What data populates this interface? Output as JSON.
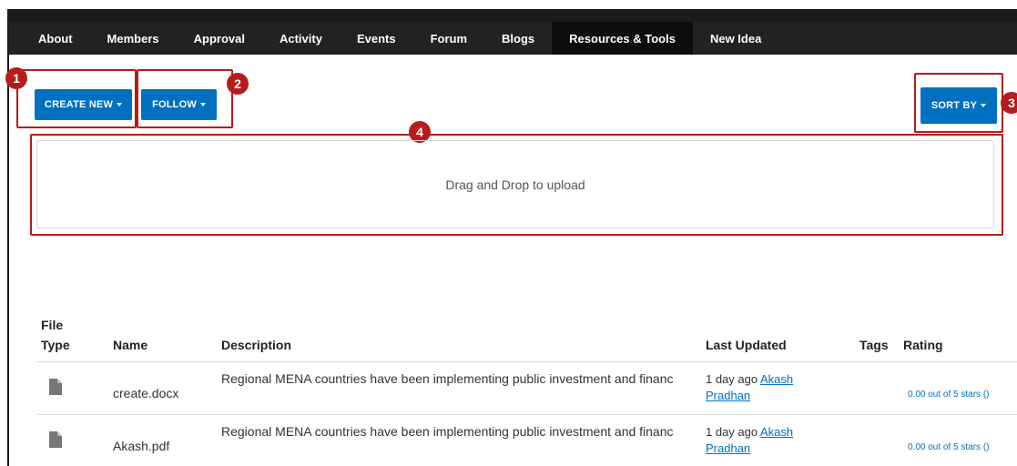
{
  "nav": {
    "items": [
      {
        "label": "About"
      },
      {
        "label": "Members"
      },
      {
        "label": "Approval"
      },
      {
        "label": "Activity"
      },
      {
        "label": "Events"
      },
      {
        "label": "Forum"
      },
      {
        "label": "Blogs"
      },
      {
        "label": "Resources & Tools",
        "active": true
      },
      {
        "label": "New Idea"
      }
    ]
  },
  "toolbar": {
    "create_new_label": "CREATE NEW",
    "follow_label": "FOLLOW",
    "sort_by_label": "SORT BY"
  },
  "callouts": [
    "1",
    "2",
    "3",
    "4"
  ],
  "dropzone": {
    "text": "Drag and Drop to upload"
  },
  "table": {
    "headers": {
      "file_type_line1": "File",
      "file_type_line2": "Type",
      "name": "Name",
      "description": "Description",
      "last_updated": "Last Updated",
      "tags": "Tags",
      "rating": "Rating"
    },
    "rows": [
      {
        "icon": "document-icon",
        "name": "create.docx",
        "description": "Regional MENA countries have been implementing public investment and financ",
        "updated": "1 day ago",
        "author": "Akash Pradhan",
        "tags": "",
        "rating": "0.00 out of 5 stars ()"
      },
      {
        "icon": "document-icon",
        "name": "Akash.pdf",
        "description": "Regional MENA countries have been implementing public investment and financ",
        "updated": "1 day ago",
        "author": "Akash Pradhan",
        "tags": "",
        "rating": "0.00 out of 5 stars ()"
      }
    ]
  },
  "colors": {
    "nav_bg": "#222222",
    "button_blue": "#0070c0",
    "callout_red": "#b71c1c"
  }
}
